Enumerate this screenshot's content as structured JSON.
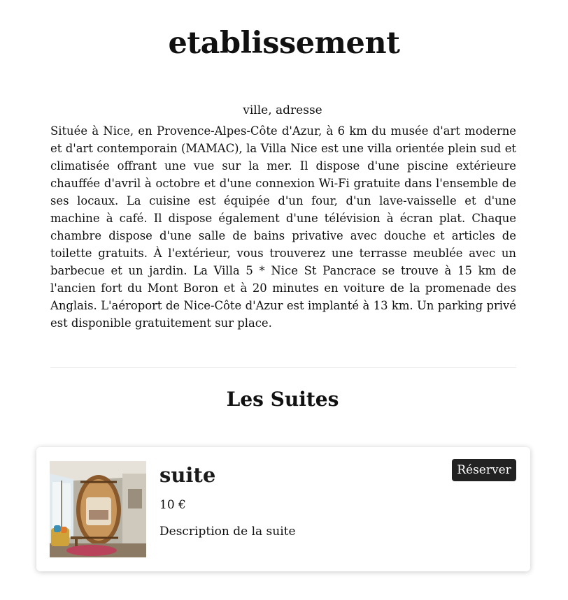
{
  "header": {
    "title": "etablissement"
  },
  "establishment": {
    "location": "ville, adresse",
    "description": "Située à Nice, en Provence-Alpes-Côte d'Azur, à 6 km du musée d'art moderne et d'art contemporain (MAMAC), la Villa Nice est une villa orientée plein sud et climatisée offrant une vue sur la mer. Il dispose d'une piscine extérieure chauffée d'avril à octobre et d'une connexion Wi-Fi gratuite dans l'ensemble de ses locaux. La cuisine est équipée d'un four, d'un lave-vaisselle et d'une machine à café. Il dispose également d'une télévision à écran plat. Chaque chambre dispose d'une salle de bains privative avec douche et articles de toilette gratuits. À l'extérieur, vous trouverez une terrasse meublée avec un barbecue et un jardin. La Villa 5 * Nice St Pancrace se trouve à 15 km de l'ancien fort du Mont Boron et à 20 minutes en voiture de la promenade des Anglais. L'aéroport de Nice-Côte d'Azur est implanté à 13 km. Un parking privé est disponible gratuitement sur place."
  },
  "suites_section": {
    "title": "Les Suites",
    "suites": [
      {
        "name": "suite",
        "price": "10 €",
        "description": "Description de la suite",
        "reserve_label": "Réserver",
        "photo": "suite-room-photo"
      }
    ]
  },
  "colors": {
    "button_bg": "#222222",
    "button_text": "#ffffff",
    "divider": "#e8e8e8"
  }
}
